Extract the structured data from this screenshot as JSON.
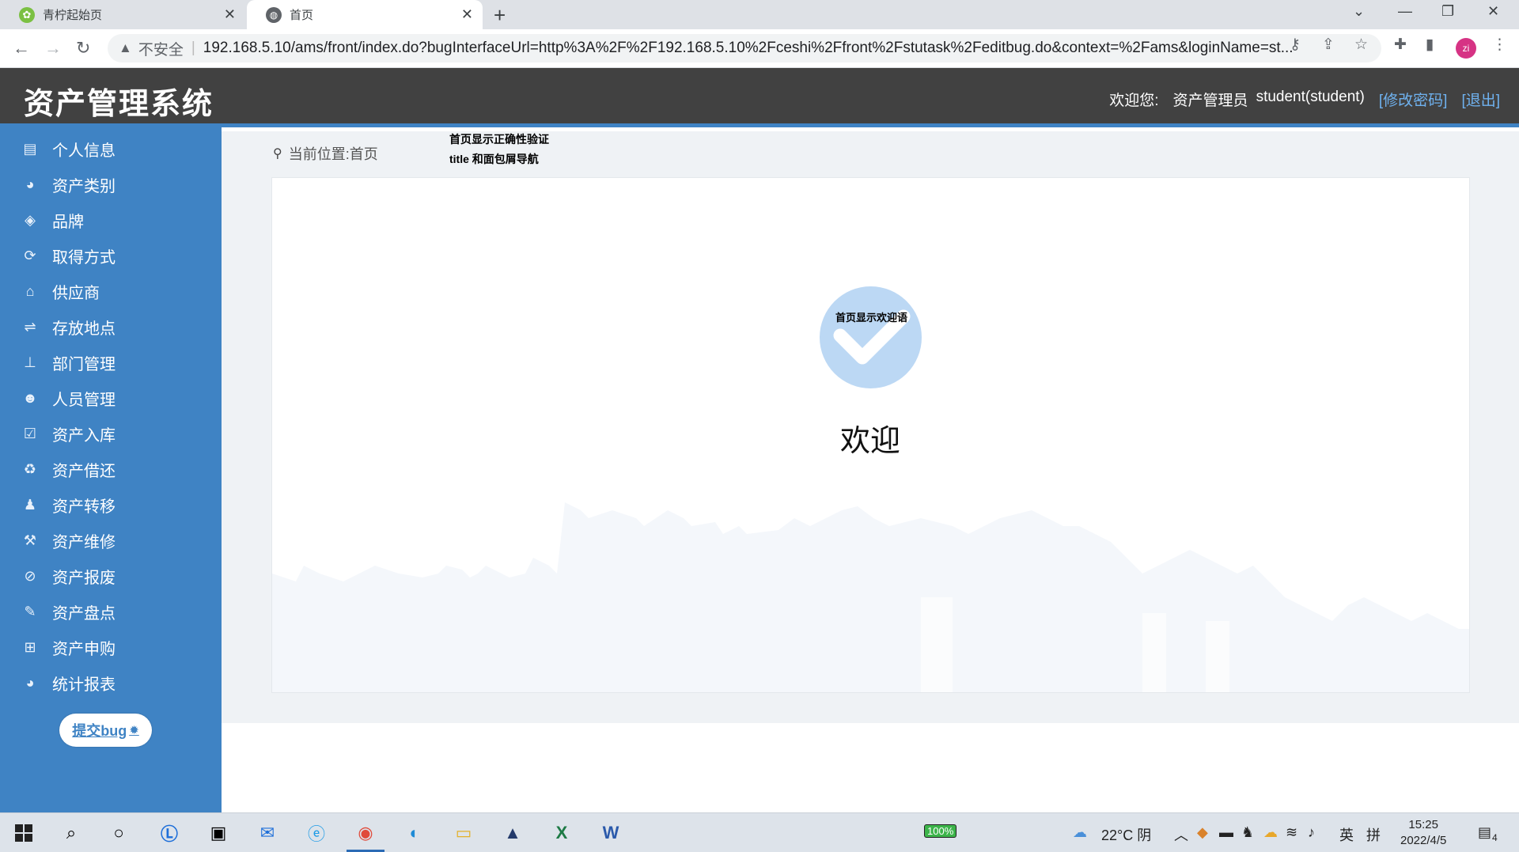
{
  "browser": {
    "tabs": [
      {
        "title": "青柠起始页",
        "icon": "lime-icon",
        "active": false
      },
      {
        "title": "首页",
        "icon": "globe-icon",
        "active": true
      }
    ],
    "security_label": "不安全",
    "url": "192.168.5.10/ams/front/index.do?bugInterfaceUrl=http%3A%2F%2F192.168.5.10%2Fceshi%2Ffront%2Fstutask%2Feditbug.do&context=%2Fams&loginName=st...",
    "profile_initials": "zi"
  },
  "app": {
    "title": "资产管理系统",
    "welcome_prefix": "欢迎您:",
    "role": "资产管理员",
    "user": "student(student)",
    "change_password": "[修改密码]",
    "logout": "[退出]"
  },
  "sidebar": {
    "items": [
      {
        "label": "个人信息",
        "icon": "id-card-icon"
      },
      {
        "label": "资产类别",
        "icon": "pie-chart-icon"
      },
      {
        "label": "品牌",
        "icon": "tags-icon"
      },
      {
        "label": "取得方式",
        "icon": "refresh-icon"
      },
      {
        "label": "供应商",
        "icon": "bank-icon"
      },
      {
        "label": "存放地点",
        "icon": "signpost-icon"
      },
      {
        "label": "部门管理",
        "icon": "sitemap-icon"
      },
      {
        "label": "人员管理",
        "icon": "users-icon"
      },
      {
        "label": "资产入库",
        "icon": "check-square-icon"
      },
      {
        "label": "资产借还",
        "icon": "recycle-icon"
      },
      {
        "label": "资产转移",
        "icon": "user-icon"
      },
      {
        "label": "资产维修",
        "icon": "wrench-icon"
      },
      {
        "label": "资产报废",
        "icon": "ban-icon"
      },
      {
        "label": "资产盘点",
        "icon": "edit-icon"
      },
      {
        "label": "资产申购",
        "icon": "cart-icon"
      },
      {
        "label": "统计报表",
        "icon": "pie-chart-icon"
      }
    ],
    "bug_button": "提交bug"
  },
  "main": {
    "breadcrumb_label": "当前位置:首页",
    "annotation_line1": "首页显示正确性验证",
    "annotation_line2": "title 和面包屑导航",
    "welcome_annotation": "首页显示欢迎语",
    "welcome_text": "欢迎"
  },
  "taskbar": {
    "battery": "100%",
    "weather": "22°C 阴",
    "ime1": "英",
    "ime2": "拼",
    "time": "15:25",
    "date": "2022/4/5",
    "notifications": "4"
  },
  "colors": {
    "header": "#414141",
    "sidebar": "#3f83c4",
    "accent_link": "#6fb2f0",
    "check_circle": "#bcd8f4"
  }
}
